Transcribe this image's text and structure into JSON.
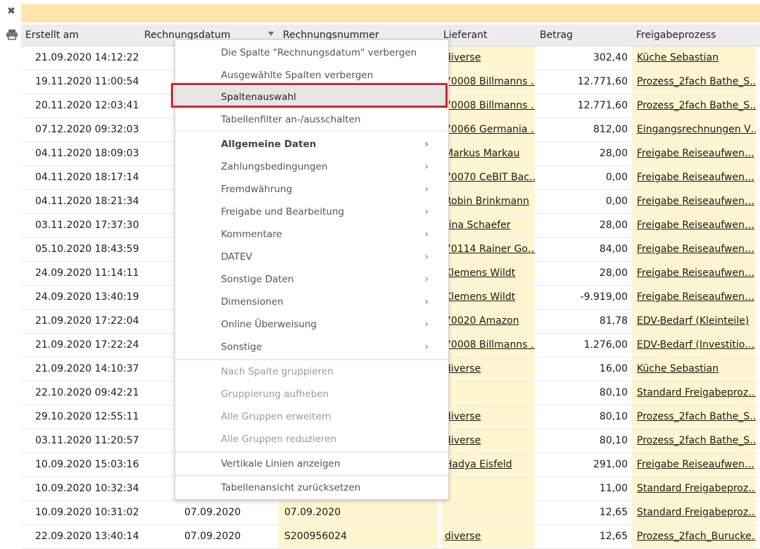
{
  "toolbar": {
    "close_icon": "✖",
    "print_icon": "printer-icon"
  },
  "columns": {
    "created": "Erstellt am",
    "invoice_date": "Rechnungsdatum",
    "invoice_number": "Rechnungsnummer",
    "supplier": "Lieferant",
    "amount": "Betrag",
    "approval": "Freigabeprozess"
  },
  "rows": [
    {
      "created": "21.09.2020 14:12:22",
      "date": "",
      "number": "",
      "supplier": "diverse",
      "amount": "302,40",
      "process": "Küche Sebastian"
    },
    {
      "created": "19.11.2020 11:00:54",
      "date": "",
      "number": "",
      "supplier": "70008 Billmanns …",
      "amount": "12.771,60",
      "process": "Prozess_2fach Bathe_S…"
    },
    {
      "created": "20.11.2020 12:03:41",
      "date": "",
      "number": "",
      "supplier": "70008 Billmanns …",
      "amount": "12.771,60",
      "process": "Prozess_2fach Bathe_S…"
    },
    {
      "created": "07.12.2020 09:32:03",
      "date": "",
      "number": "",
      "supplier": "70066 Germania …",
      "amount": "812,00",
      "process": "Eingangsrechnungen V…"
    },
    {
      "created": "04.11.2020 18:09:03",
      "date": "",
      "number": "",
      "supplier": "Markus Markau",
      "amount": "28,00",
      "process": "Freigabe Reiseaufwen…"
    },
    {
      "created": "04.11.2020 18:17:14",
      "date": "",
      "number": "",
      "supplier": "70070 CeBIT Bac…",
      "amount": "0,00",
      "process": "Freigabe Reiseaufwen…"
    },
    {
      "created": "04.11.2020 18:21:34",
      "date": "",
      "number": "",
      "supplier": "Robin Brinkmann",
      "amount": "0,00",
      "process": "Freigabe Reiseaufwen…"
    },
    {
      "created": "03.11.2020 17:37:30",
      "date": "",
      "number": "",
      "supplier": "rina Schaefer",
      "amount": "28,00",
      "process": "Freigabe Reiseaufwen…"
    },
    {
      "created": "05.10.2020 18:43:59",
      "date": "",
      "number": "",
      "supplier": "70114 Rainer Go…",
      "amount": "84,00",
      "process": "Freigabe Reiseaufwen…"
    },
    {
      "created": "24.09.2020 11:14:11",
      "date": "",
      "number": "",
      "supplier": "Klemens Wildt",
      "amount": "28,00",
      "process": "Freigabe Reiseaufwen…"
    },
    {
      "created": "24.09.2020 13:40:19",
      "date": "",
      "number": "",
      "supplier": "Klemens Wildt",
      "amount": "-9.919,00",
      "process": "Freigabe Reiseaufwen…"
    },
    {
      "created": "21.09.2020 17:22:04",
      "date": "",
      "number": "",
      "supplier": "70020 Amazon",
      "amount": "81,78",
      "process": "EDV-Bedarf (Kleinteile)"
    },
    {
      "created": "21.09.2020 17:22:24",
      "date": "",
      "number": "",
      "supplier": "70008 Billmanns …",
      "amount": "1.276,00",
      "process": "EDV-Bedarf (Investitio…"
    },
    {
      "created": "21.09.2020 14:10:37",
      "date": "",
      "number": "",
      "supplier": "diverse",
      "amount": "16,00",
      "process": "Küche Sebastian"
    },
    {
      "created": "22.10.2020 09:42:21",
      "date": "",
      "number": "",
      "supplier": "",
      "amount": "80,10",
      "process": "Standard Freigabeproz…"
    },
    {
      "created": "29.10.2020 12:55:11",
      "date": "",
      "number": "",
      "supplier": "diverse",
      "amount": "80,10",
      "process": "Prozess_2fach Bathe_S…"
    },
    {
      "created": "03.11.2020 11:20:57",
      "date": "",
      "number": "",
      "supplier": "diverse",
      "amount": "80,10",
      "process": "Prozess_2fach Bathe_S…"
    },
    {
      "created": "10.09.2020 15:03:16",
      "date": "",
      "number": "",
      "supplier": "Hadya Eisfeld",
      "amount": "291,00",
      "process": "Freigabe Reiseaufwen…"
    },
    {
      "created": "10.09.2020 10:32:34",
      "date": "",
      "number": "",
      "supplier": "",
      "amount": "11,00",
      "process": "Standard Freigabeproz…"
    },
    {
      "created": "10.09.2020 10:31:02",
      "date": "07.09.2020",
      "number": "07.09.2020",
      "supplier": "",
      "amount": "12,65",
      "process": "Standard Freigabeproz…"
    },
    {
      "created": "22.09.2020 13:40:14",
      "date": "07.09.2020",
      "number": "S200956024",
      "supplier": "diverse",
      "amount": "12,65",
      "process": "Prozess_2fach_Burucke…"
    }
  ],
  "context_menu": {
    "hide_column": "Die Spalte \"Rechnungsdatum\" verbergen",
    "hide_selected": "Ausgewählte Spalten verbergen",
    "column_chooser": "Spaltenauswahl",
    "toggle_filter": "Tabellenfilter an-/ausschalten",
    "general_data": "Allgemeine Daten",
    "payment_terms": "Zahlungsbedingungen",
    "foreign_currency": "Fremdwährung",
    "approval_processing": "Freigabe und Bearbeitung",
    "comments": "Kommentare",
    "datev": "DATEV",
    "other_data": "Sonstige Daten",
    "dimensions": "Dimensionen",
    "online_transfer": "Online Überweisung",
    "misc": "Sonstige",
    "group_by_column": "Nach Spalte gruppieren",
    "ungroup": "Gruppierung aufheben",
    "expand_all": "Alle Gruppen erweitern",
    "collapse_all": "Alle Gruppen reduzieren",
    "vertical_lines": "Vertikale Linien anzeigen",
    "reset_view": "Tabellenansicht zurücksetzen",
    "chevron": "›"
  },
  "colors": {
    "highlight_border": "#d6232a",
    "filter_bar": "#fde5ad",
    "cell_highlight": "#fff5cf"
  }
}
